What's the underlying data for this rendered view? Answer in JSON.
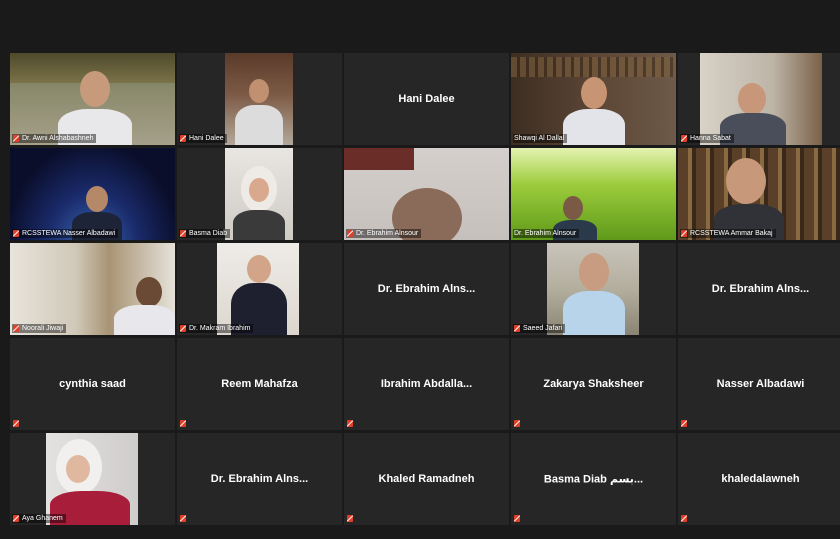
{
  "tiles": [
    {
      "name": "Dr. Awni Alshabashneh",
      "type": "video",
      "active": true
    },
    {
      "name": "Hani Dalee",
      "type": "video"
    },
    {
      "name": "Hani Dalee",
      "type": "name"
    },
    {
      "name": "Shawqi Al Dallal",
      "type": "video"
    },
    {
      "name": "Hanna Sabat",
      "type": "video"
    },
    {
      "name": "RCSSTEWA Nasser Albadawi",
      "type": "video"
    },
    {
      "name": "Basma Diab",
      "type": "video"
    },
    {
      "name": "Dr. Ebrahim Alnsour",
      "type": "video"
    },
    {
      "name": "Dr. Ebrahim Alnsour",
      "type": "video"
    },
    {
      "name": "RCSSTEWA Ammar Bakaj",
      "type": "video"
    },
    {
      "name": "Noorali Jiwaji",
      "type": "video"
    },
    {
      "name": "Dr. Makram Ibrahim",
      "type": "video"
    },
    {
      "name": "Dr. Ebrahim Alns...",
      "type": "name"
    },
    {
      "name": "Saeed Jafari",
      "type": "video"
    },
    {
      "name": "Dr. Ebrahim Alns...",
      "type": "name"
    },
    {
      "name": "cynthia saad",
      "type": "name"
    },
    {
      "name": "Reem Mahafza",
      "type": "name"
    },
    {
      "name": "Ibrahim Abdalla...",
      "type": "name"
    },
    {
      "name": "Zakarya Shaksheer",
      "type": "name"
    },
    {
      "name": "Nasser Albadawi",
      "type": "name"
    },
    {
      "name": "Aya Ghanem",
      "type": "video"
    },
    {
      "name": "Dr. Ebrahim Alns...",
      "type": "name"
    },
    {
      "name": "Khaled Ramadneh",
      "type": "name"
    },
    {
      "name": "Basma Diab بسم...",
      "type": "name"
    },
    {
      "name": "khaledalawneh",
      "type": "name"
    }
  ],
  "colors": {
    "background": "#1a1a1a",
    "tile": "#262626",
    "active_border": "#c7e56e",
    "muted_mic": "#e0402a"
  }
}
